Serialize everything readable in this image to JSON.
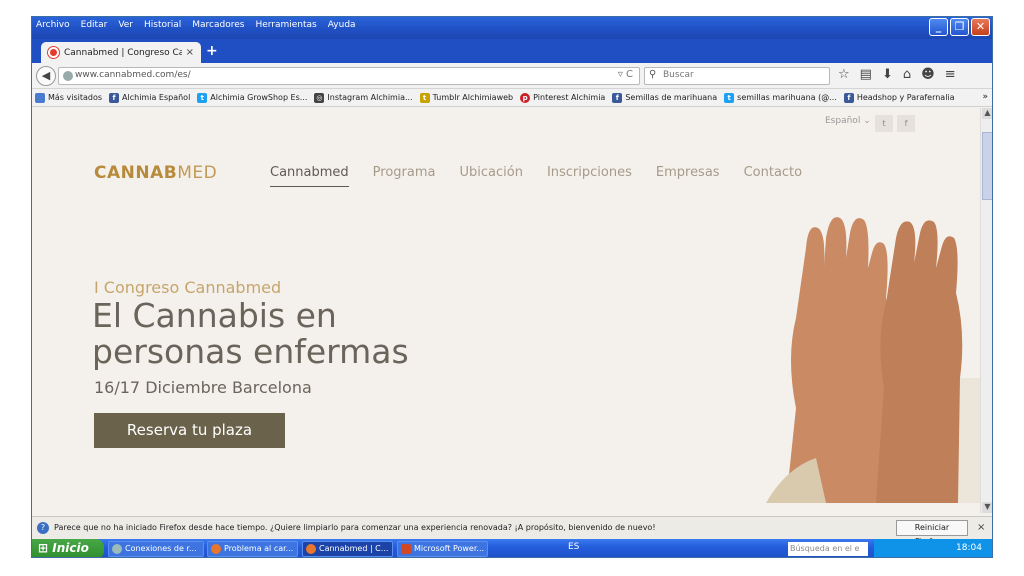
{
  "menubar": [
    "Archivo",
    "Editar",
    "Ver",
    "Historial",
    "Marcadores",
    "Herramientas",
    "Ayuda"
  ],
  "tab": {
    "title": "Cannabmed | Congreso Can...",
    "close": "×",
    "new_tab": "+"
  },
  "navbar": {
    "url": "www.cannabmed.com/es/",
    "search_placeholder": "Buscar"
  },
  "bookmarks": [
    {
      "label": "Más visitados",
      "icon": "folder-icon",
      "color": "#4a7bd0"
    },
    {
      "label": "Alchimia Español",
      "icon": "facebook-icon",
      "color": "#3b5998"
    },
    {
      "label": "Alchimia GrowShop Es...",
      "icon": "twitter-icon",
      "color": "#1da1f2"
    },
    {
      "label": "Instagram Alchimia...",
      "icon": "instagram-icon",
      "color": "#444444"
    },
    {
      "label": "Tumblr Alchimiaweb",
      "icon": "tumblr-icon",
      "color": "#c8a200"
    },
    {
      "label": "Pinterest Alchimia",
      "icon": "pinterest-icon",
      "color": "#cb2027"
    },
    {
      "label": "Semillas de marihuana",
      "icon": "facebook-icon",
      "color": "#3b5998"
    },
    {
      "label": "semillas marihuana (@...",
      "icon": "twitter-icon",
      "color": "#1da1f2"
    },
    {
      "label": "Headshop y Parafernalia",
      "icon": "facebook-icon",
      "color": "#3b5998"
    }
  ],
  "page": {
    "language": "Español",
    "social": [
      "twitter-icon",
      "facebook-icon"
    ],
    "logo_bold": "CANNAB",
    "logo_thin": "MED",
    "nav": [
      "Cannabmed",
      "Programa",
      "Ubicación",
      "Inscripciones",
      "Empresas",
      "Contacto"
    ],
    "hero_kicker": "I Congreso Cannabmed",
    "hero_title_line1": "El Cannabis en",
    "hero_title_line2": "personas enfermas",
    "hero_date": "16/17 Diciembre Barcelona",
    "cta": "Reserva tu plaza"
  },
  "notification": {
    "text": "Parece que no ha iniciado Firefox desde hace tiempo. ¿Quiere limpiarlo para comenzar una experiencia renovada? ¡A propósito, bienvenido de nuevo!",
    "button": "Reiniciar Firefox...",
    "close": "×"
  },
  "taskbar": {
    "start": "Inicio",
    "items": [
      "Conexiones de r...",
      "Problema al car...",
      "Cannabmed | C...",
      "Microsoft Power..."
    ],
    "language": "ES",
    "search_placeholder": "Búsqueda en el e",
    "clock": "18:04"
  },
  "colors": {
    "accent": "#b88a3b",
    "cta": "#6a624b",
    "xp_blue": "#245ddb",
    "xp_green": "#2f8d2d"
  }
}
